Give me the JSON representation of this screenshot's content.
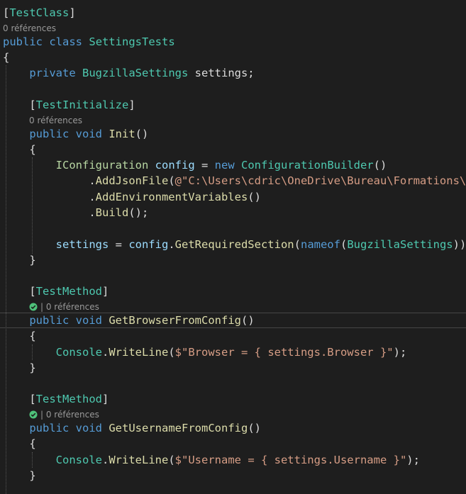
{
  "code": {
    "test_class_attr": "TestClass",
    "references_0": "0 références",
    "kw_public": "public",
    "kw_class": "class",
    "class_name": "SettingsTests",
    "kw_private": "private",
    "settings_type": "BugzillaSettings",
    "settings_field": "settings;",
    "test_initialize_attr": "TestInitialize",
    "kw_void": "void",
    "init_method": "Init",
    "iconfiguration": "IConfiguration",
    "config_var": "config",
    "kw_new": "new",
    "configuration_builder": "ConfigurationBuilder",
    "add_json_file": "AddJsonFile",
    "json_path": "@\"C:\\Users\\cdric\\OneDrive\\Bureau\\Formations\\F",
    "add_env_vars": "AddEnvironmentVariables",
    "build": "Build",
    "settings_assign": "settings",
    "get_required_section": "GetRequiredSection",
    "kw_nameof": "nameof",
    "test_method_attr": "TestMethod",
    "get_browser_method": "GetBrowserFromConfig",
    "console": "Console",
    "write_line": "WriteLine",
    "browser_string": "$\"Browser = { settings.Browser }\"",
    "get_username_method": "GetUsernameFromConfig",
    "username_string": "$\"Username = { settings.Username }\""
  },
  "colors": {
    "background": "#1e1e1e",
    "keyword": "#569cd6",
    "class_name": "#4ec9b0",
    "interface": "#b8d7a3",
    "method": "#dcdcaa",
    "string": "#d69d85",
    "test_passed_check": "#4ec27a"
  },
  "icons": {
    "test_status": "test-passed-check-icon"
  }
}
